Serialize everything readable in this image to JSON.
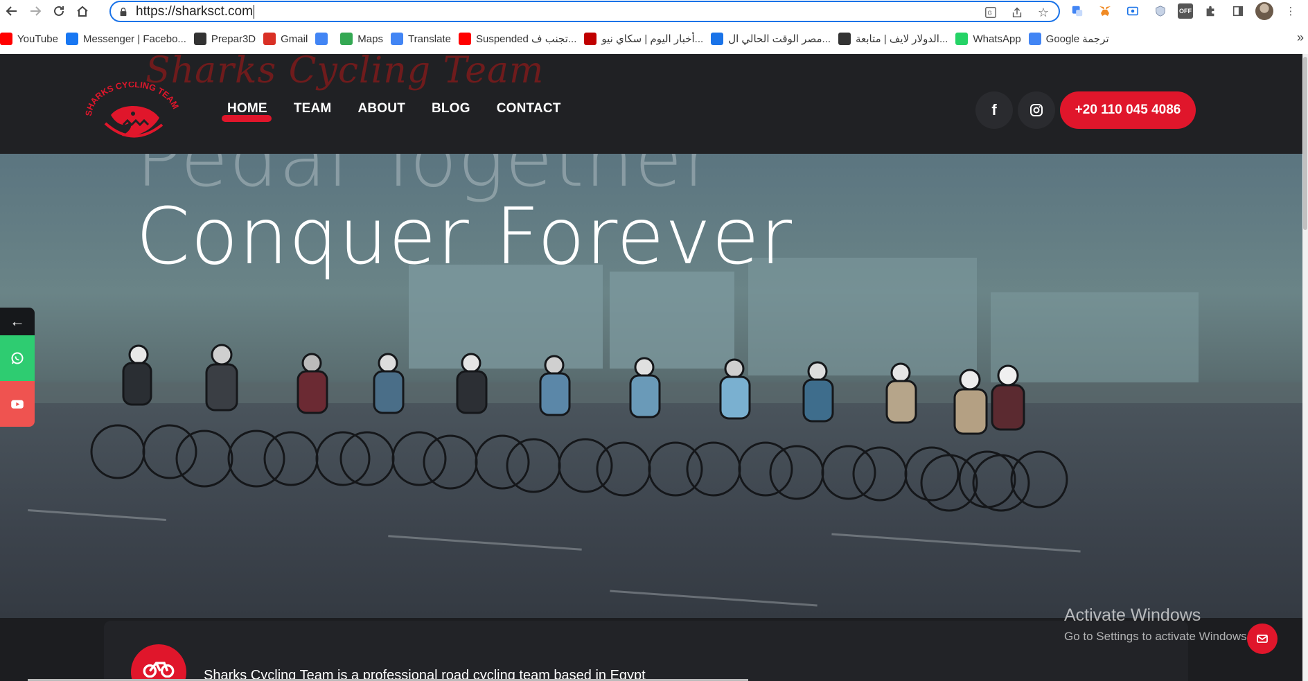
{
  "browser": {
    "url": "https://sharksct.com",
    "bookmarks": [
      {
        "label": "YouTube",
        "icon": "youtube-icon",
        "color": "#ff0000"
      },
      {
        "label": "Messenger | Facebo...",
        "icon": "facebook-icon",
        "color": "#1877f2"
      },
      {
        "label": "Prepar3D",
        "icon": "prepar3d-icon",
        "color": "#333333"
      },
      {
        "label": "Gmail",
        "icon": "gmail-icon",
        "color": "#d93025"
      },
      {
        "label": "",
        "icon": "google-translate-icon",
        "color": "#4285f4"
      },
      {
        "label": "Maps",
        "icon": "maps-icon",
        "color": "#34a853"
      },
      {
        "label": "Translate",
        "icon": "translate-icon",
        "color": "#4285f4"
      },
      {
        "label": "Suspended تجنب ف...",
        "icon": "youtube-icon",
        "color": "#ff0000"
      },
      {
        "label": "أخبار اليوم | سكاي نيو...",
        "icon": "news-icon",
        "color": "#c00000"
      },
      {
        "label": "مصر الوقت الحالي ال...",
        "icon": "location-icon",
        "color": "#1a73e8"
      },
      {
        "label": "الدولار لايف | متابعة...",
        "icon": "dollar-icon",
        "color": "#333333"
      },
      {
        "label": "WhatsApp",
        "icon": "whatsapp-icon",
        "color": "#25d366"
      },
      {
        "label": "Google ترجمة",
        "icon": "google-translate-icon",
        "color": "#4285f4"
      }
    ]
  },
  "site": {
    "ghost_title": "Sharks Cycling Team",
    "logo_text": "SHARKS CYCLING TEAM",
    "nav": [
      "HOME",
      "TEAM",
      "ABOUT",
      "BLOG",
      "CONTACT"
    ],
    "phone": "+20 110 045 4086",
    "hero_line1": "Pedal Together",
    "hero_line2": "Conquer Forever",
    "intro": "Sharks Cycling Team is a professional road cycling team based in Egypt",
    "brand_color": "#e0162b"
  },
  "watermark": {
    "line1": "Activate Windows",
    "line2": "Go to Settings to activate Windows."
  }
}
